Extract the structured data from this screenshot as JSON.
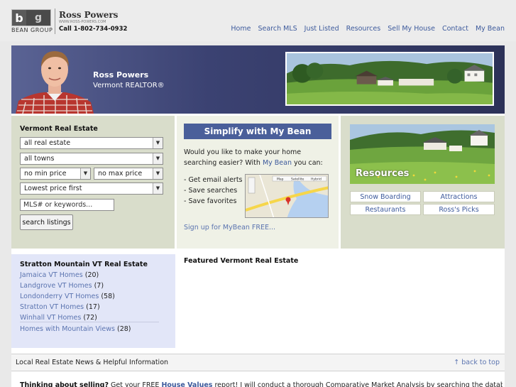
{
  "header": {
    "logo_b": "b",
    "logo_g": "g",
    "brand": "BEAN GROUP",
    "agent_name": "Ross Powers",
    "agent_site": "WWW.ROSS-POWERS.COM",
    "agent_phone": "Call 1-802-734-0932",
    "nav": [
      "Home",
      "Search MLS",
      "Just Listed",
      "Resources",
      "Sell My House",
      "Contact",
      "My Bean"
    ]
  },
  "banner": {
    "name": "Ross Powers",
    "title": "Vermont REALTOR®"
  },
  "search": {
    "title": "Vermont Real Estate",
    "property_type": "all real estate",
    "towns": "all towns",
    "min_price": "no min price",
    "max_price": "no max price",
    "sort": "Lowest price first",
    "keyword_placeholder": "MLS# or keywords...",
    "button": "search listings"
  },
  "mybean": {
    "heading": "Simplify with My Bean",
    "intro_1": "Would you like to make your home searching easier? With ",
    "intro_link": "My Bean",
    "intro_2": " you can:",
    "features": [
      "- Get email alerts",
      "- Save searches",
      "- Save favorites"
    ],
    "map_tabs": [
      "Map",
      "Satellite",
      "Hybrid"
    ],
    "signup": "Sign up for MyBean FREE..."
  },
  "resources": {
    "label": "Resources",
    "links": [
      "Snow Boarding",
      "Attractions",
      "Restaurants",
      "Ross's Picks"
    ]
  },
  "stratton": {
    "title": "Stratton Mountain VT Real Estate",
    "items": [
      {
        "name": "Jamaica VT Homes",
        "count": "(20)"
      },
      {
        "name": "Landgrove VT Homes",
        "count": "(7)"
      },
      {
        "name": "Londonderry VT Homes",
        "count": "(58)"
      },
      {
        "name": "Stratton VT Homes",
        "count": "(17)"
      },
      {
        "name": "Winhall VT Homes",
        "count": "(72)"
      }
    ],
    "mountain_views": {
      "name": "Homes with Mountain Views",
      "count": "(28)"
    }
  },
  "featured": {
    "title": "Featured Vermont Real Estate"
  },
  "news": {
    "title": "Local Real Estate News & Helpful Information",
    "back_to_top": "↑ back to top"
  },
  "selling": {
    "lead": "Thinking about selling?",
    "text_1": " Get your FREE ",
    "link": "House Values",
    "text_2": " report! I will conduct a thorough Comparative Market Analysis by searching the database of all homes"
  },
  "colors": {
    "nav_link": "#3d5a9c",
    "banner_blue": "#3b4272",
    "sage_panel": "#d9ddcb",
    "lavender_panel": "#e2e6f8"
  }
}
